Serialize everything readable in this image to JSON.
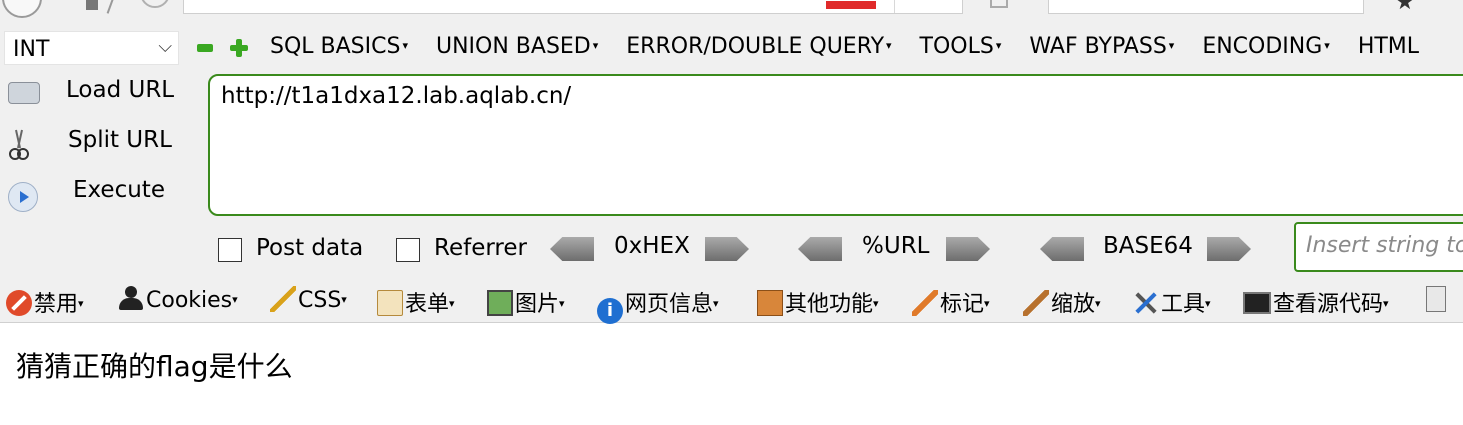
{
  "hackbar": {
    "type_select": "INT",
    "menus": [
      "SQL BASICS",
      "UNION BASED",
      "ERROR/DOUBLE QUERY",
      "TOOLS",
      "WAF BYPASS",
      "ENCODING",
      "HTML"
    ],
    "load_url": "Load URL",
    "split_url": "Split URL",
    "execute": "Execute",
    "url": "http://t1a1dxa12.lab.aqlab.cn/",
    "post_data": "Post data",
    "referrer": "Referrer",
    "hex": "0xHEX",
    "url_enc": "%URL",
    "base64": "BASE64",
    "insert_placeholder": "Insert string to"
  },
  "devbar": {
    "disable": "禁用",
    "cookies": "Cookies",
    "css": "CSS",
    "forms": "表单",
    "images": "图片",
    "info": "网页信息",
    "misc": "其他功能",
    "mark": "标记",
    "zoom": "缩放",
    "tools": "工具",
    "view_source": "查看源代码"
  },
  "page": {
    "text": "猜猜正确的flag是什么"
  }
}
